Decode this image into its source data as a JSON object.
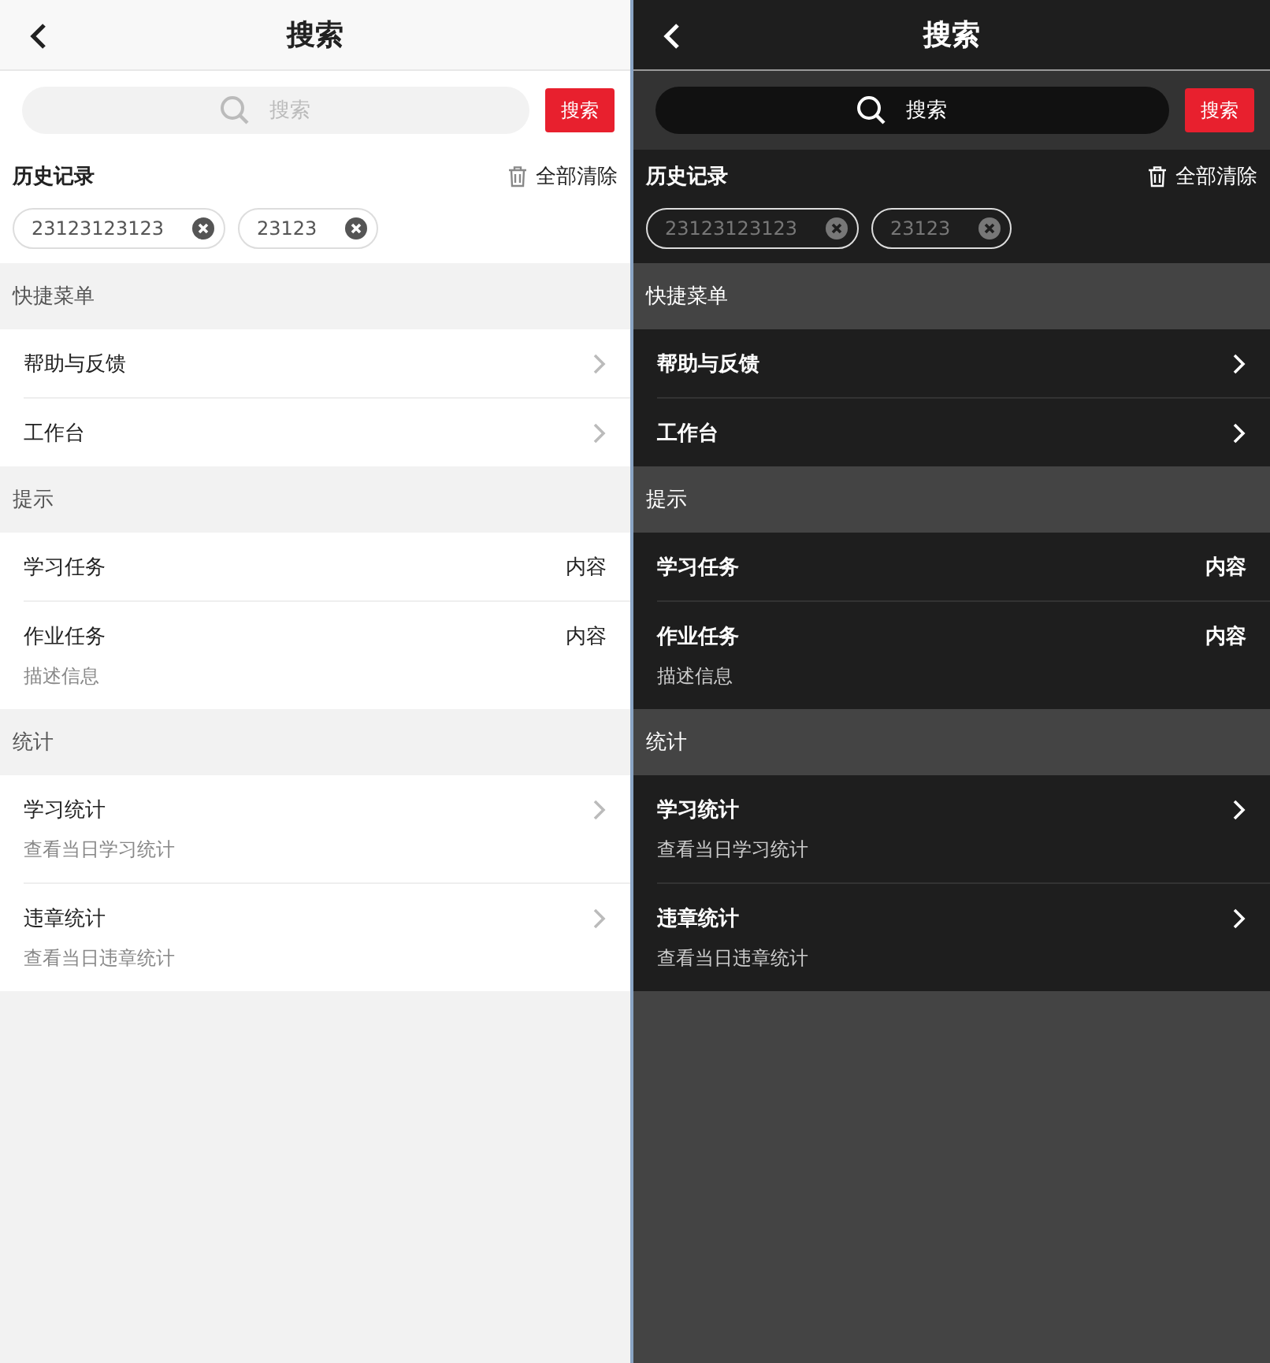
{
  "panels": [
    {
      "kind": "light",
      "title": "搜索",
      "search": {
        "placeholder": "搜索",
        "button": "搜索"
      },
      "history": {
        "title": "历史记录",
        "clear": "全部清除",
        "tags": [
          "23123123123",
          "23123"
        ]
      },
      "groups": [
        {
          "title": "快捷菜单",
          "items": [
            {
              "kind": "link",
              "title": "帮助与反馈"
            },
            {
              "kind": "link",
              "title": "工作台"
            }
          ]
        },
        {
          "title": "提示",
          "items": [
            {
              "kind": "value",
              "title": "学习任务",
              "value": "内容"
            },
            {
              "kind": "value",
              "title": "作业任务",
              "value": "内容",
              "description": "描述信息"
            }
          ]
        },
        {
          "title": "统计",
          "items": [
            {
              "kind": "link",
              "title": "学习统计",
              "description": "查看当日学习统计"
            },
            {
              "kind": "link",
              "title": "违章统计",
              "description": "查看当日违章统计"
            }
          ]
        }
      ]
    },
    {
      "kind": "dark",
      "title": "搜索",
      "search": {
        "placeholder": "搜索",
        "button": "搜索"
      },
      "history": {
        "title": "历史记录",
        "clear": "全部清除",
        "tags": [
          "23123123123",
          "23123"
        ]
      },
      "groups": [
        {
          "title": "快捷菜单",
          "items": [
            {
              "kind": "link",
              "title": "帮助与反馈"
            },
            {
              "kind": "link",
              "title": "工作台"
            }
          ]
        },
        {
          "title": "提示",
          "items": [
            {
              "kind": "value",
              "title": "学习任务",
              "value": "内容"
            },
            {
              "kind": "value",
              "title": "作业任务",
              "value": "内容",
              "description": "描述信息"
            }
          ]
        },
        {
          "title": "统计",
          "items": [
            {
              "kind": "link",
              "title": "学习统计",
              "description": "查看当日学习统计"
            },
            {
              "kind": "link",
              "title": "违章统计",
              "description": "查看当日违章统计"
            }
          ]
        }
      ]
    }
  ]
}
